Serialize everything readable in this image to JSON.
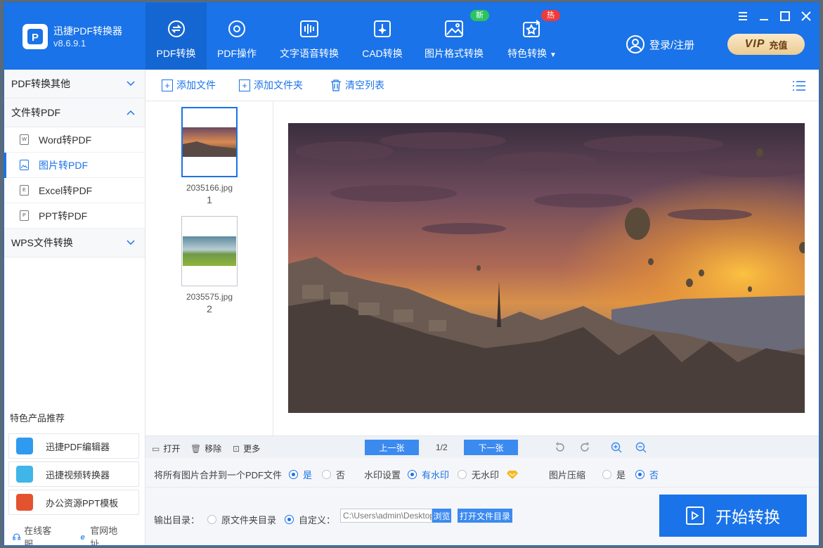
{
  "app": {
    "name": "迅捷PDF转换器",
    "version": "v8.6.9.1"
  },
  "nav": {
    "tabs": [
      {
        "label": "PDF转换",
        "icon": "pdf-convert-icon"
      },
      {
        "label": "PDF操作",
        "icon": "pdf-operate-icon"
      },
      {
        "label": "文字语音转换",
        "icon": "voice-wave-icon"
      },
      {
        "label": "CAD转换",
        "icon": "cad-icon"
      },
      {
        "label": "图片格式转换",
        "icon": "image-icon"
      },
      {
        "label": "特色转换",
        "icon": "star-convert-icon"
      }
    ],
    "badge_new": "新",
    "badge_hot": "热",
    "login": "登录/注册",
    "vip": "VIP",
    "vip_action": "充值"
  },
  "sidebar": {
    "groups": [
      "PDF转换其他",
      "文件转PDF",
      "WPS文件转换"
    ],
    "items": [
      {
        "label": "Word转PDF",
        "tag": "W"
      },
      {
        "label": "图片转PDF",
        "tag": "img"
      },
      {
        "label": "Excel转PDF",
        "tag": "E"
      },
      {
        "label": "PPT转PDF",
        "tag": "P"
      }
    ],
    "featured_title": "特色产品推荐",
    "featured": [
      "迅捷PDF编辑器",
      "迅捷视频转换器",
      "办公资源PPT模板"
    ],
    "footer": [
      "在线客服",
      "官网地址"
    ]
  },
  "toolbar": {
    "add_file": "添加文件",
    "add_folder": "添加文件夹",
    "clear": "清空列表"
  },
  "files": [
    {
      "name": "2035166.jpg",
      "index": "1"
    },
    {
      "name": "2035575.jpg",
      "index": "2"
    }
  ],
  "preview_bar": {
    "open": "打开",
    "remove": "移除",
    "more": "更多",
    "prev": "上一张",
    "page": "1/2",
    "next": "下一张"
  },
  "options": {
    "merge_label": "将所有图片合并到一个PDF文件",
    "yes": "是",
    "no": "否",
    "watermark_label": "水印设置",
    "with_watermark": "有水印",
    "no_watermark": "无水印",
    "compress_label": "图片压缩"
  },
  "output": {
    "label": "输出目录：",
    "source_dir": "原文件夹目录",
    "custom": "自定义：",
    "path": "C:\\Users\\admin\\Desktop",
    "browse": "浏览",
    "open_dir": "打开文件目录"
  },
  "start_button": "开始转换",
  "colors": {
    "primary": "#1a73e8",
    "badge_new": "#2bc35f",
    "badge_hot": "#f03a3a"
  }
}
